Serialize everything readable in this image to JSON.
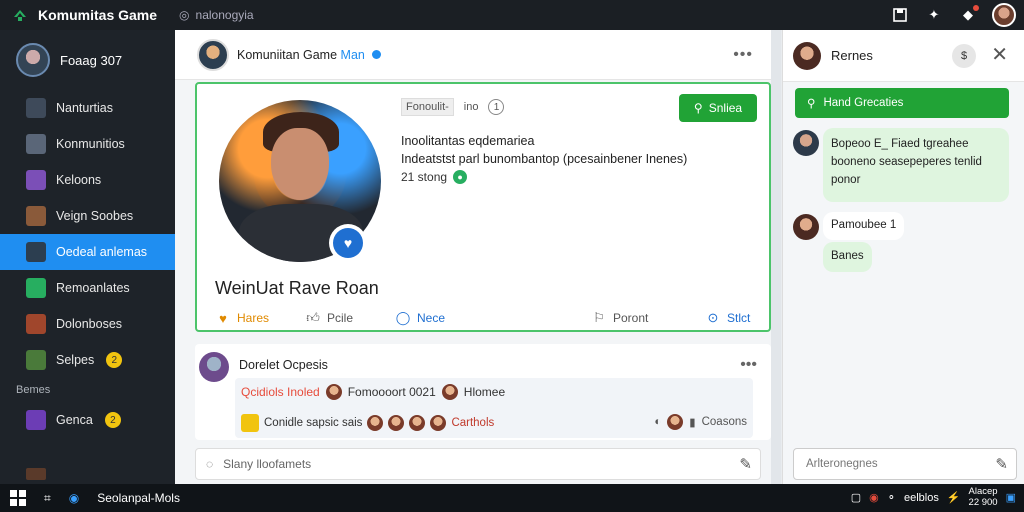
{
  "topbar": {
    "app_title": "Komumitas Game",
    "search_text": "nalonogyia",
    "icons": [
      "logo-icon",
      "search-icon",
      "save-icon",
      "puzzle-icon",
      "notifications-icon",
      "avatar"
    ]
  },
  "sidebar": {
    "profile_name": "Foaag 307",
    "items": [
      {
        "label": "Nanturtias",
        "icon": "list-icon",
        "color": "#3e4a5a"
      },
      {
        "label": "Konmunitios",
        "icon": "tools-icon",
        "color": "#5a6678"
      },
      {
        "label": "Keloons",
        "icon": "pencil-icon",
        "color": "#7b4fb7"
      },
      {
        "label": "Veign Soobes",
        "icon": "game-icon",
        "color": "#8a5a3a"
      },
      {
        "label": "Oedeal anlemas",
        "icon": "avatar-icon",
        "color": "#2c3e50",
        "active": true
      },
      {
        "label": "Remoanlates",
        "icon": "check-icon",
        "color": "#27ae60"
      },
      {
        "label": "Dolonboses",
        "icon": "game-icon",
        "color": "#a0462c"
      },
      {
        "label": "Selpes",
        "icon": "game-icon",
        "color": "#4a7a3a",
        "badge": "2"
      }
    ],
    "section_title": "Bemes",
    "section_items": [
      {
        "label": "Genca",
        "icon": "game-icon",
        "color": "#6c3db5",
        "badge": "2"
      }
    ]
  },
  "post": {
    "author": "Komuniitan Game",
    "author_sub": "Man",
    "tag_label": "Fonoulit-",
    "tag_extra": "ino",
    "tag_number": "1",
    "join_label": "Snliea",
    "line1": "Inoolitantas eqdemariea",
    "line2": "Indeatstst parl bunombantop (pcesainbener Inenes)",
    "line3": "21 stong",
    "hero_name": "WeinUat Rave Roan",
    "actions": [
      "Hares",
      "Pcile",
      "Nece",
      "Poront",
      "Stlct"
    ]
  },
  "post2": {
    "author": "Dorelet Ocpesis",
    "row1_red": "Qcidiols Inoled",
    "row1_mid": "Fomoooort 0021",
    "row1_end": "Hlomee",
    "row2_text": "Conidle sapsic sais",
    "row2_red": "Carthols",
    "row2_right": "Coasons"
  },
  "comment_placeholder": "Slany lloofamets",
  "chat": {
    "title": "Rernes",
    "filter_label": "Hand Grecaties",
    "bubble1_title": "Bopeoo E_ Fiaed tgreahee",
    "bubble1_body": "booneno seasepeperes tenlid",
    "bubble1_tail": "ponor",
    "bubble2": "Pamoubee 1",
    "bubble3": "Banes",
    "input_placeholder": "Arlteronegnes"
  },
  "taskbar": {
    "app_label": "Seolanpal-Mols",
    "tray_text": "eelblos",
    "clock_line1": "Alacep",
    "clock_line2": "22 900"
  },
  "colors": {
    "accent_blue": "#1f8ef1",
    "accent_green": "#21a336",
    "sidebar_bg": "#1e2329",
    "topbar_bg": "#1b1f24"
  }
}
